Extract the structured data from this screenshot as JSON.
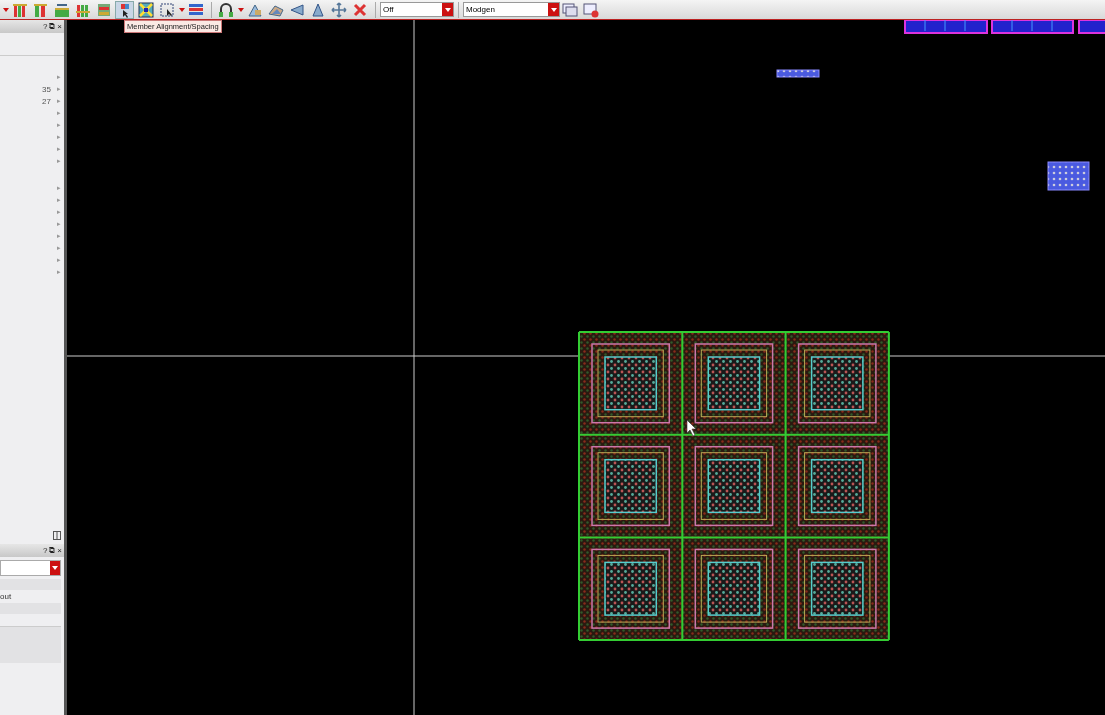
{
  "toolbar": {
    "items": [
      {
        "kind": "caret"
      },
      {
        "kind": "columns",
        "hovered": false
      },
      {
        "kind": "columns2",
        "hovered": false
      },
      {
        "kind": "rows",
        "hovered": false
      },
      {
        "kind": "columns3",
        "hovered": false
      },
      {
        "kind": "stack",
        "hovered": false
      },
      {
        "kind": "align",
        "hovered": true
      },
      {
        "kind": "xbox",
        "hovered": false
      },
      {
        "kind": "select",
        "hovered": false
      },
      {
        "kind": "caret"
      },
      {
        "kind": "grid",
        "hovered": false
      },
      {
        "kind": "sep"
      },
      {
        "kind": "arch",
        "hovered": false
      },
      {
        "kind": "caret"
      },
      {
        "kind": "shape",
        "hovered": false
      },
      {
        "kind": "shape2",
        "hovered": false
      },
      {
        "kind": "tri-left",
        "hovered": false
      },
      {
        "kind": "tri-up",
        "hovered": false
      },
      {
        "kind": "move",
        "hovered": false
      },
      {
        "kind": "delete",
        "hovered": false
      },
      {
        "kind": "sep"
      },
      {
        "kind": "dropdown",
        "value": "Off"
      },
      {
        "kind": "sep"
      },
      {
        "kind": "dropdown",
        "value": "Modgen"
      },
      {
        "kind": "window",
        "hovered": false
      },
      {
        "kind": "window-x",
        "hovered": false
      }
    ],
    "tooltip": "Member Alignment/Spacing"
  },
  "top_panel": {
    "buttons": [
      "?",
      "⧉",
      "×"
    ],
    "groups": [
      {
        "rows": [
          {
            "arrow": "▸"
          },
          {
            "arrow": "▸",
            "count": "35"
          },
          {
            "arrow": "▸",
            "count": "27"
          },
          {
            "arrow": "▸"
          },
          {
            "arrow": "▸"
          },
          {
            "arrow": "▸"
          },
          {
            "arrow": "▸"
          },
          {
            "arrow": "▸"
          }
        ]
      },
      {
        "rows": [
          {
            "arrow": "▸"
          },
          {
            "arrow": "▸"
          },
          {
            "arrow": "▸"
          },
          {
            "arrow": "▸"
          },
          {
            "arrow": "▸"
          },
          {
            "arrow": "▸"
          },
          {
            "arrow": "▸"
          },
          {
            "arrow": "▸"
          }
        ]
      }
    ]
  },
  "bottom_panel": {
    "buttons": [
      "?",
      "⧉",
      "×"
    ],
    "label": "out"
  }
}
